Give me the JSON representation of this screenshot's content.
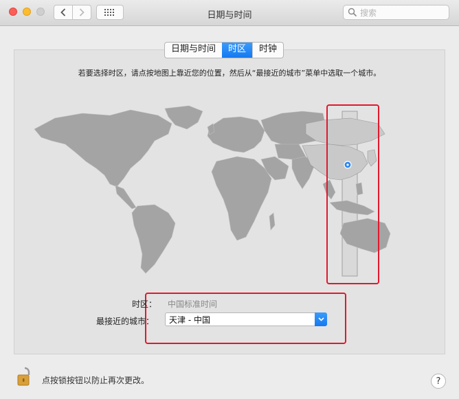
{
  "window": {
    "title": "日期与时间",
    "search_placeholder": "搜索"
  },
  "tabs": [
    {
      "label": "日期与时间",
      "active": false
    },
    {
      "label": "时区",
      "active": true
    },
    {
      "label": "时钟",
      "active": false
    }
  ],
  "instruction": "若要选择时区，请点按地图上靠近您的位置，然后从“最接近的城市”菜单中选取一个城市。",
  "timezone": {
    "label": "时区：",
    "value": "中国标准时间"
  },
  "closest_city": {
    "label": "最接近的城市：",
    "value": "天津 - 中国"
  },
  "footer": {
    "lock_text": "点按锁按钮以防止再次更改。",
    "help_label": "?"
  },
  "colors": {
    "accent": "#1a7ff3",
    "highlight": "#e0182d"
  }
}
